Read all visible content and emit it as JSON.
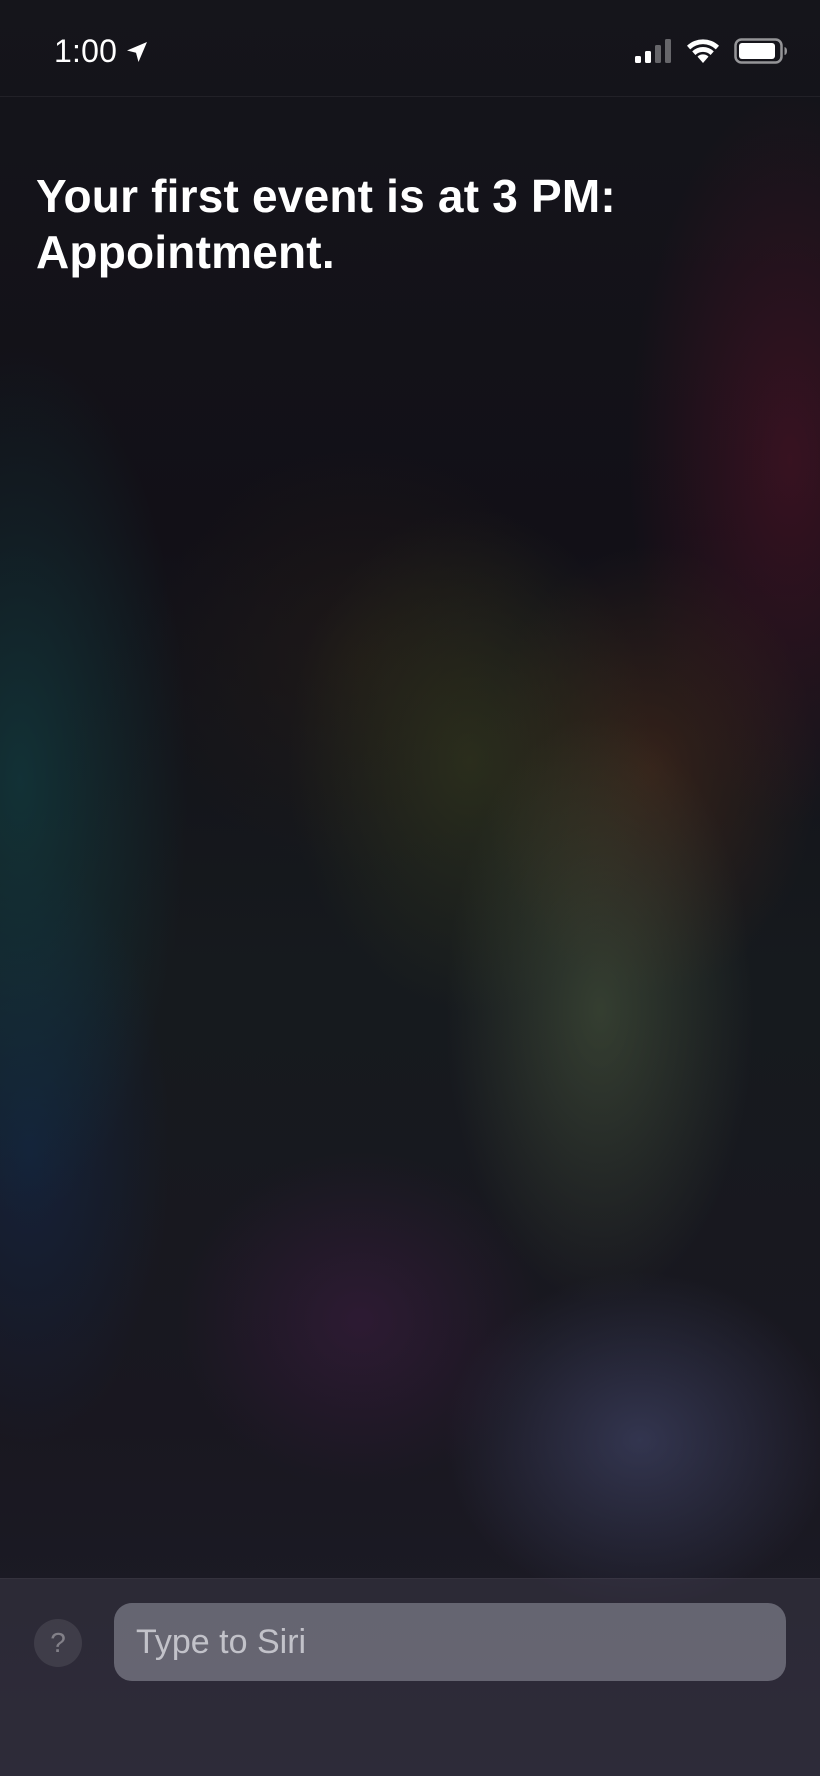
{
  "status_bar": {
    "time": "1:00",
    "icons": [
      "location-arrow-icon",
      "cellular-signal-icon",
      "wifi-icon",
      "battery-icon"
    ]
  },
  "siri": {
    "response_line_1": "Your first event is at 3 PM:",
    "response_line_2": "Appointment."
  },
  "input_bar": {
    "help_label": "?",
    "placeholder": "Type to Siri",
    "value": ""
  },
  "colors": {
    "text": "#ffffff",
    "input_background": "#8a8a98",
    "placeholder": "#d6d6dc"
  }
}
